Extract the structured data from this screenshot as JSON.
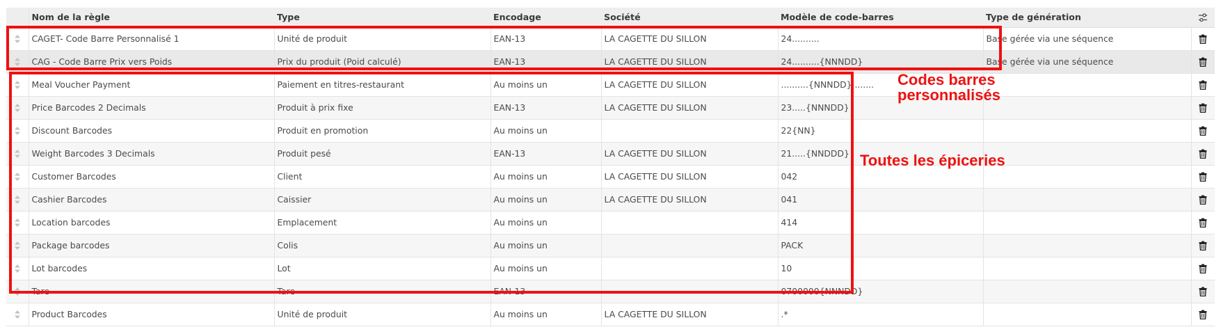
{
  "columns": [
    "Nom de la règle",
    "Type",
    "Encodage",
    "Société",
    "Modèle de code-barres",
    "Type de génération"
  ],
  "icons": {
    "row_handle": "sort-handle-icon",
    "row_action": "trash-icon",
    "header_options": "column-options-icon"
  },
  "rows": [
    {
      "name": "CAGET- Code Barre Personnalisé 1",
      "type": "Unité de produit",
      "encoding": "EAN-13",
      "company": "LA CAGETTE DU SILLON",
      "pattern": "24..........",
      "generation": "Base gérée via une séquence"
    },
    {
      "name": "CAG - Code Barre Prix vers Poids",
      "type": "Prix du produit (Poid calculé)",
      "encoding": "EAN-13",
      "company": "LA CAGETTE DU SILLON",
      "pattern": "24..........{NNNDD}",
      "generation": "Base gérée via une séquence"
    },
    {
      "name": "Meal Voucher Payment",
      "type": "Paiement en titres-restaurant",
      "encoding": "Au moins un",
      "company": "LA CAGETTE DU SILLON",
      "pattern": "..........{NNNDD}........",
      "generation": ""
    },
    {
      "name": "Price Barcodes 2 Decimals",
      "type": "Produit à prix fixe",
      "encoding": "EAN-13",
      "company": "LA CAGETTE DU SILLON",
      "pattern": "23.....{NNNDD}",
      "generation": ""
    },
    {
      "name": "Discount Barcodes",
      "type": "Produit en promotion",
      "encoding": "Au moins un",
      "company": "",
      "pattern": "22{NN}",
      "generation": ""
    },
    {
      "name": "Weight Barcodes 3 Decimals",
      "type": "Produit pesé",
      "encoding": "EAN-13",
      "company": "LA CAGETTE DU SILLON",
      "pattern": "21.....{NNDDD}",
      "generation": ""
    },
    {
      "name": "Customer Barcodes",
      "type": "Client",
      "encoding": "Au moins un",
      "company": "LA CAGETTE DU SILLON",
      "pattern": "042",
      "generation": ""
    },
    {
      "name": "Cashier Barcodes",
      "type": "Caissier",
      "encoding": "Au moins un",
      "company": "LA CAGETTE DU SILLON",
      "pattern": "041",
      "generation": ""
    },
    {
      "name": "Location barcodes",
      "type": "Emplacement",
      "encoding": "Au moins un",
      "company": "",
      "pattern": "414",
      "generation": ""
    },
    {
      "name": "Package barcodes",
      "type": "Colis",
      "encoding": "Au moins un",
      "company": "",
      "pattern": "PACK",
      "generation": ""
    },
    {
      "name": "Lot barcodes",
      "type": "Lot",
      "encoding": "Au moins un",
      "company": "",
      "pattern": "10",
      "generation": ""
    },
    {
      "name": "Tare",
      "type": "Tare",
      "encoding": "EAN-13",
      "company": "",
      "pattern": "0700000{NNNDD}",
      "generation": ""
    },
    {
      "name": "Product Barcodes",
      "type": "Unité de produit",
      "encoding": "Au moins un",
      "company": "LA CAGETTE DU SILLON",
      "pattern": ".*",
      "generation": ""
    }
  ],
  "annotations": {
    "custom_line1": "Codes barres",
    "custom_line2": "personnalisés",
    "all_stores": "Toutes les épiceries",
    "color": "#ee1111"
  }
}
